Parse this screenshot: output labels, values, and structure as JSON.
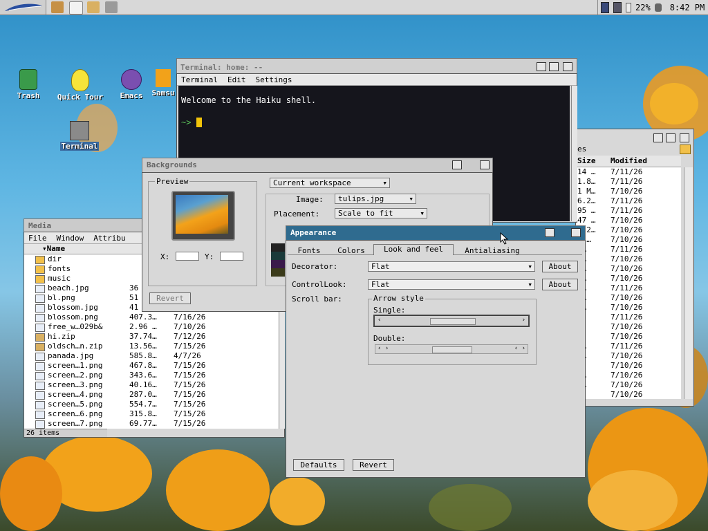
{
  "deskbar": {
    "battery": "22%",
    "clock": "8:42 PM"
  },
  "desktop_icons": [
    {
      "label": "Trash"
    },
    {
      "label": "Quick Tour"
    },
    {
      "label": "Emacs"
    },
    {
      "label": "Samsu"
    },
    {
      "label": "Terminal"
    }
  ],
  "terminal": {
    "title": "Terminal: home: --",
    "menu": [
      "Terminal",
      "Edit",
      "Settings"
    ],
    "line1": "Welcome to the Haiku shell.",
    "prompt": "~>"
  },
  "backgrounds": {
    "title": "Backgrounds",
    "preview_label": "Preview",
    "x_label": "X:",
    "y_label": "Y:",
    "workspace_select": "Current workspace",
    "image_label": "Image:",
    "image_value": "tulips.jpg",
    "placement_label": "Placement:",
    "placement_value": "Scale to fit",
    "revert_label": "Revert"
  },
  "media": {
    "title": "Media",
    "menu": [
      "File",
      "Window",
      "Attribu"
    ],
    "col_name": "Name",
    "status": "26 items",
    "rows": [
      {
        "name": "dir",
        "size": "",
        "date": "",
        "kind": "folder"
      },
      {
        "name": "fonts",
        "size": "",
        "date": "",
        "kind": "folder"
      },
      {
        "name": "music",
        "size": "",
        "date": "",
        "kind": "folder"
      },
      {
        "name": "beach.jpg",
        "size": "36",
        "date": "",
        "kind": "file"
      },
      {
        "name": "bl.png",
        "size": "51",
        "date": "",
        "kind": "file"
      },
      {
        "name": "blossom.jpg",
        "size": "41",
        "date": "",
        "kind": "file"
      },
      {
        "name": "blossom.png",
        "size": "407.3…",
        "date": "7/16/26",
        "kind": "file"
      },
      {
        "name": "free_w…029b&",
        "size": "2.96 …",
        "date": "7/10/26",
        "kind": "file"
      },
      {
        "name": "hi.zip",
        "size": "37.74…",
        "date": "7/12/26",
        "kind": "zip"
      },
      {
        "name": "oldsch…n.zip",
        "size": "13.56…",
        "date": "7/15/26",
        "kind": "zip"
      },
      {
        "name": "panada.jpg",
        "size": "585.8…",
        "date": "4/7/26",
        "kind": "file"
      },
      {
        "name": "screen…1.png",
        "size": "467.8…",
        "date": "7/15/26",
        "kind": "file"
      },
      {
        "name": "screen…2.png",
        "size": "343.6…",
        "date": "7/15/26",
        "kind": "file"
      },
      {
        "name": "screen…3.png",
        "size": "40.16…",
        "date": "7/15/26",
        "kind": "file"
      },
      {
        "name": "screen…4.png",
        "size": "287.0…",
        "date": "7/15/26",
        "kind": "file"
      },
      {
        "name": "screen…5.png",
        "size": "554.7…",
        "date": "7/15/26",
        "kind": "file"
      },
      {
        "name": "screen…6.png",
        "size": "315.8…",
        "date": "7/15/26",
        "kind": "file"
      },
      {
        "name": "screen…7.png",
        "size": "69.77…",
        "date": "7/15/26",
        "kind": "file"
      }
    ]
  },
  "right_tracker": {
    "title_partial": "es",
    "col_size": "Size",
    "col_modified": "Modified",
    "rows": [
      {
        "size": "14 …",
        "date": "7/11/26"
      },
      {
        "size": "1.8…",
        "date": "7/11/26"
      },
      {
        "size": "1 M…",
        "date": "7/10/26"
      },
      {
        "size": "6.2…",
        "date": "7/11/26"
      },
      {
        "size": "95 …",
        "date": "7/11/26"
      },
      {
        "size": "47 …",
        "date": "7/10/26"
      },
      {
        "size": "3.2…",
        "date": "7/10/26"
      },
      {
        "size": "7 …",
        "date": "7/10/26"
      },
      {
        "size": "6…",
        "date": "7/11/26"
      },
      {
        "size": "5…",
        "date": "7/10/26"
      },
      {
        "size": "4…",
        "date": "7/10/26"
      },
      {
        "size": "4…",
        "date": "7/10/26"
      },
      {
        "size": "5…",
        "date": "7/11/26"
      },
      {
        "size": "4…",
        "date": "7/10/26"
      },
      {
        "size": "8…",
        "date": "7/10/26"
      },
      {
        "size": "…",
        "date": "7/11/26"
      },
      {
        "size": "…",
        "date": "7/10/26"
      },
      {
        "size": "…",
        "date": "7/10/26"
      },
      {
        "size": "7…",
        "date": "7/11/26"
      },
      {
        "size": "2…",
        "date": "7/10/26"
      },
      {
        "size": "…",
        "date": "7/10/26"
      },
      {
        "size": "5…",
        "date": "7/10/26"
      },
      {
        "size": "7…",
        "date": "7/10/26"
      },
      {
        "size": "…",
        "date": "7/10/26"
      }
    ]
  },
  "appearance": {
    "title": "Appearance",
    "tabs": [
      "Fonts",
      "Colors",
      "Look and feel",
      "Antialiasing"
    ],
    "decorator_label": "Decorator:",
    "decorator_value": "Flat",
    "controllook_label": "ControlLook:",
    "controllook_value": "Flat",
    "about_label": "About",
    "scrollbar_label": "Scroll bar:",
    "arrow_style_label": "Arrow style",
    "single_label": "Single:",
    "double_label": "Double:",
    "defaults_label": "Defaults",
    "revert_label": "Revert"
  }
}
